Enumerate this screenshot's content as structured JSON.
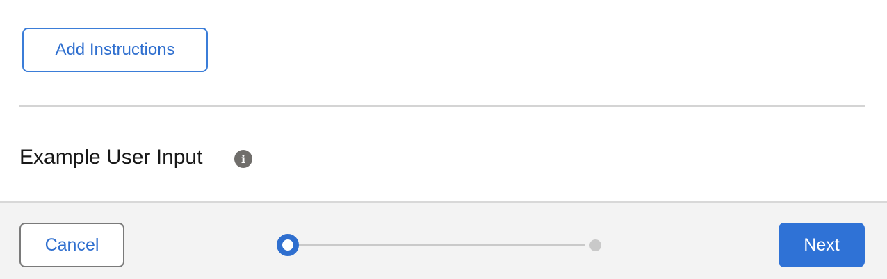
{
  "content": {
    "add_instructions_label": "Add Instructions",
    "section_title": "Example User Input",
    "info_icon": "info-icon"
  },
  "footer": {
    "cancel_label": "Cancel",
    "next_label": "Next",
    "progress": {
      "total_steps": 2,
      "current_step": 1
    }
  },
  "colors": {
    "accent": "#2f72d6",
    "divider": "#d4d4d4",
    "footer_background": "#f3f3f3",
    "upcoming_step": "#c9c9c9"
  }
}
